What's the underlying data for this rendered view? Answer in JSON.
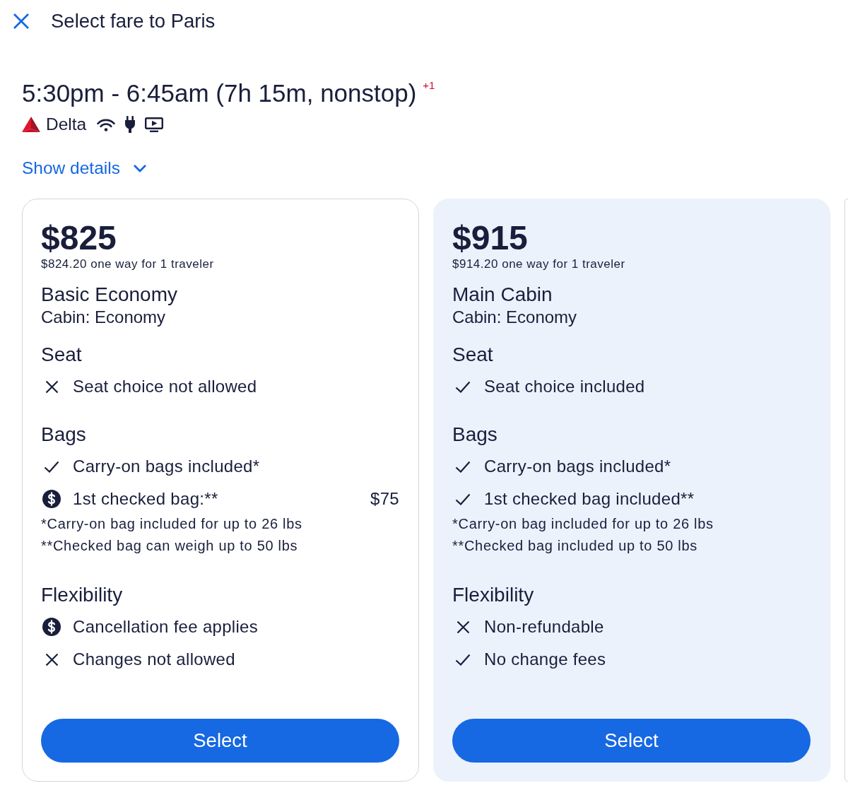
{
  "header": {
    "title": "Select fare to Paris"
  },
  "flight": {
    "times": "5:30pm - 6:45am (7h 15m, nonstop)",
    "day_offset": "+1",
    "airline": "Delta",
    "amenities": [
      {
        "kind": "wifi"
      },
      {
        "kind": "power"
      },
      {
        "kind": "entertainment"
      }
    ],
    "details_link": "Show details",
    "expanded": false
  },
  "fares": [
    {
      "selected": false,
      "price": "$825",
      "price_note": "$824.20 one way for 1 traveler",
      "name": "Basic Economy",
      "cabin": "Cabin: Economy",
      "sections": [
        {
          "title": "Seat",
          "items": [
            {
              "kind": "not_included",
              "text": "Seat choice not allowed"
            }
          ]
        },
        {
          "title": "Bags",
          "items": [
            {
              "kind": "included",
              "text": "Carry-on bags included*"
            },
            {
              "kind": "fee",
              "text": "1st checked bag:**",
              "price": "$75"
            }
          ],
          "notes": [
            "*Carry-on bag included for up to 26 lbs",
            "**Checked bag can weigh up to 50 lbs"
          ]
        },
        {
          "title": "Flexibility",
          "items": [
            {
              "kind": "fee",
              "text": "Cancellation fee applies"
            },
            {
              "kind": "not_included",
              "text": "Changes not allowed"
            }
          ]
        }
      ],
      "button": "Select"
    },
    {
      "selected": true,
      "price": "$915",
      "price_note": "$914.20 one way for 1 traveler",
      "name": "Main Cabin",
      "cabin": "Cabin: Economy",
      "sections": [
        {
          "title": "Seat",
          "items": [
            {
              "kind": "included",
              "text": "Seat choice included"
            }
          ]
        },
        {
          "title": "Bags",
          "items": [
            {
              "kind": "included",
              "text": "Carry-on bags included*"
            },
            {
              "kind": "included",
              "text": "1st checked bag included**"
            }
          ],
          "notes": [
            "*Carry-on bag included for up to 26 lbs",
            "**Checked bag included up to 50 lbs"
          ]
        },
        {
          "title": "Flexibility",
          "items": [
            {
              "kind": "not_included",
              "text": "Non-refundable"
            },
            {
              "kind": "included",
              "text": "No change fees"
            }
          ]
        }
      ],
      "button": "Select"
    }
  ]
}
